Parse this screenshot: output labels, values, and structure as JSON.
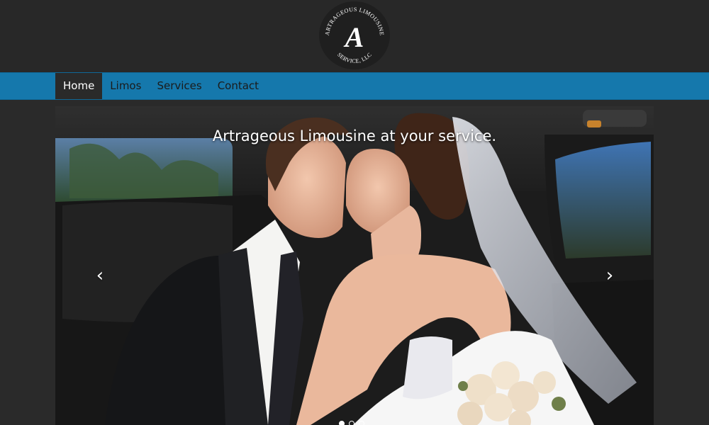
{
  "brand": {
    "logo_letter": "A",
    "logo_text_top": "ARTRAGEOUS LIMOUSINE",
    "logo_text_bottom": "SERVICE, LLC"
  },
  "nav": {
    "items": [
      {
        "label": "Home",
        "active": true
      },
      {
        "label": "Limos",
        "active": false
      },
      {
        "label": "Services",
        "active": false
      },
      {
        "label": "Contact",
        "active": false
      }
    ]
  },
  "carousel": {
    "caption": "Artrageous Limousine at your service.",
    "prev_icon": "‹",
    "next_icon": "›",
    "slide_count": 3,
    "active_slide": 0
  },
  "colors": {
    "page_background": "#2a2a2a",
    "header_background": "#282828",
    "navbar": "#1578ac",
    "nav_active_background": "#2a2a2a",
    "nav_text": "#1b1b1b",
    "caption_text": "#ffffff"
  }
}
